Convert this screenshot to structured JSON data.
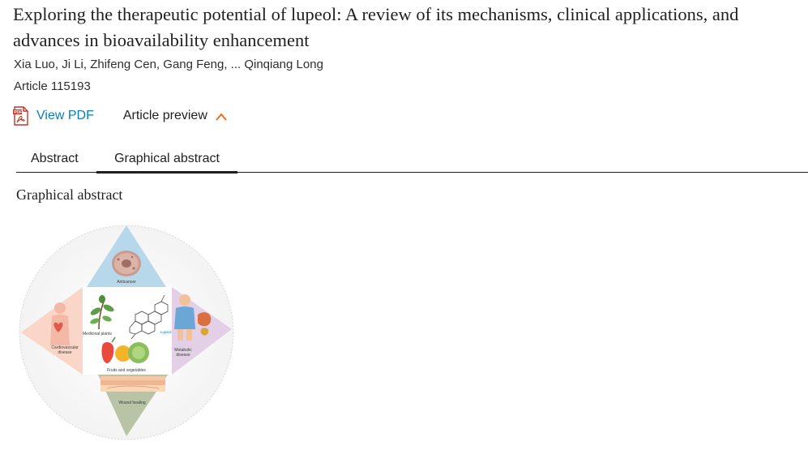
{
  "article": {
    "title": "Exploring the therapeutic potential of lupeol: A review of its mechanisms, clinical applications, and advances in bioavailability enhancement",
    "authors": "Xia Luo, Ji Li, Zhifeng Cen, Gang Feng, ... Qinqiang Long",
    "article_number": "Article 115193"
  },
  "actions": {
    "view_pdf": "View PDF",
    "pdf_icon": "pdf-file-icon",
    "article_preview": "Article preview",
    "preview_icon": "chevron-up-icon"
  },
  "tabs": [
    {
      "label": "Abstract",
      "active": false
    },
    {
      "label": "Graphical abstract",
      "active": true
    }
  ],
  "section": {
    "heading": "Graphical abstract"
  },
  "figure": {
    "labels": {
      "anticancer": "Anticancer",
      "cardio_line1": "Cardiovascular",
      "cardio_line2": "disease",
      "metabolic_line1": "Metabolic",
      "metabolic_line2": "disease",
      "wound": "Wound healing",
      "plants": "Medicinal plants",
      "fruits": "Fruits and vegetables",
      "compound": "Lupeol"
    },
    "colors": {
      "top": "#b7d7ea",
      "left": "#fad6c8",
      "right": "#e3cfe6",
      "bottom": "#b9c4a7",
      "link": "#0c7dbb"
    }
  }
}
